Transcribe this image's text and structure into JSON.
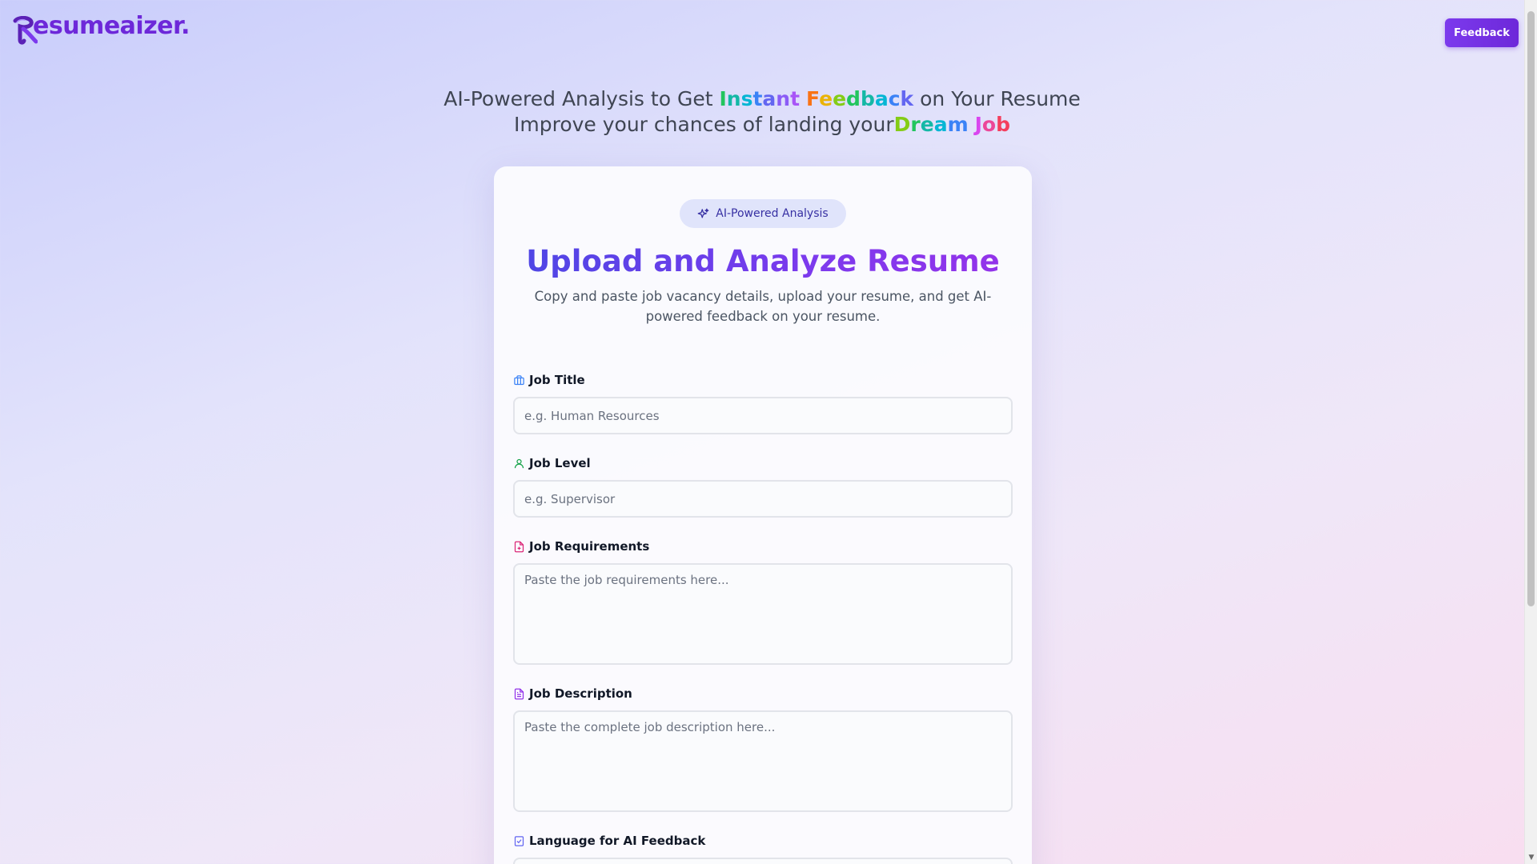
{
  "header": {
    "logo_text": "esumeaizer.",
    "logo_letter": "R",
    "feedback_label": "Feedback"
  },
  "hero": {
    "line1_prefix": "AI-Powered Analysis to Get ",
    "line1_highlight_a": "Instant",
    "line1_highlight_b": "Feedback",
    "line1_suffix": " on Your Resume",
    "line2_prefix": "Improve your chances of landing your",
    "line2_highlight_a": "Dream",
    "line2_highlight_b": "Job"
  },
  "card": {
    "badge_label": "AI-Powered Analysis",
    "title": "Upload and Analyze Resume",
    "subtitle": "Copy and paste job vacancy details, upload your resume, and get AI-powered feedback on your resume.",
    "fields": [
      {
        "label": "Job Title",
        "placeholder": "e.g. Human Resources",
        "icon": "briefcase-icon",
        "color": "#3b82f6"
      },
      {
        "label": "Job Level",
        "placeholder": "e.g. Supervisor",
        "icon": "user-icon",
        "color": "#16a34a"
      },
      {
        "label": "Job Requirements",
        "placeholder": "Paste the job requirements here...",
        "icon": "document-icon",
        "color": "#db2777"
      },
      {
        "label": "Job Description",
        "placeholder": "Paste the complete job description here...",
        "icon": "file-text-icon",
        "color": "#9333ea"
      },
      {
        "label": "Language for AI Feedback",
        "icon": "checklist-icon",
        "color": "#6366f1"
      }
    ]
  },
  "colors": {
    "brand": "#6d28d9",
    "accent": "#7c3aed"
  }
}
